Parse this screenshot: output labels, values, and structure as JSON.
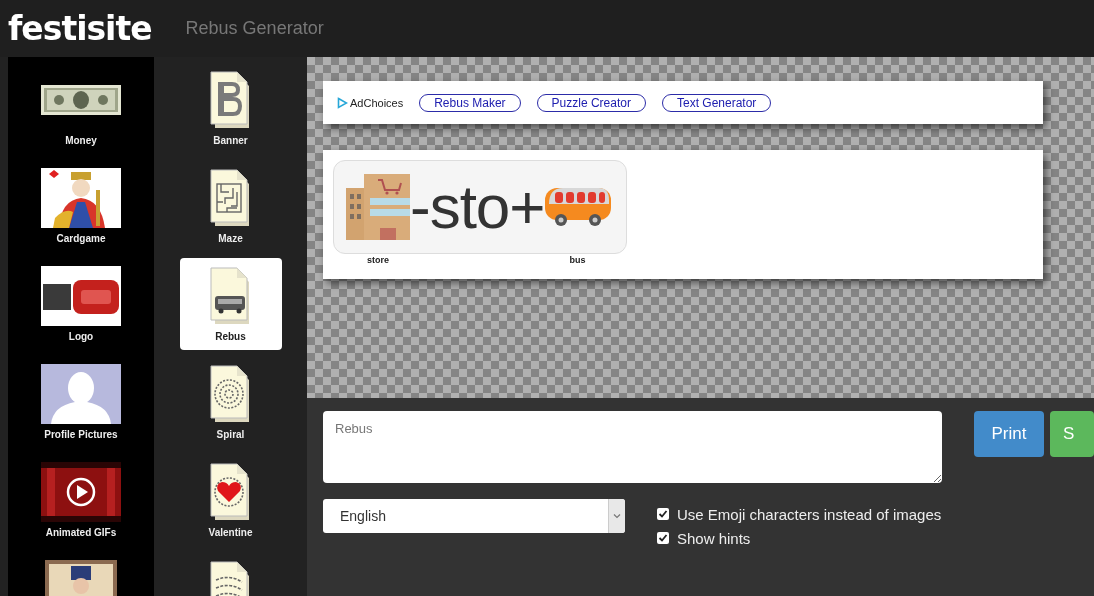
{
  "header": {
    "logo": "festisite",
    "title": "Rebus Generator"
  },
  "sidebar": {
    "columns": [
      {
        "items": [
          {
            "label": "Money",
            "selected": false
          },
          {
            "label": "Cardgame",
            "selected": false
          },
          {
            "label": "Logo",
            "selected": false
          },
          {
            "label": "Profile Pictures",
            "selected": false
          },
          {
            "label": "Animated GIFs",
            "selected": false
          },
          {
            "selected": false
          }
        ]
      },
      {
        "items": [
          {
            "label": "Banner",
            "selected": false
          },
          {
            "label": "Maze",
            "selected": false
          },
          {
            "label": "Rebus",
            "selected": true
          },
          {
            "label": "Spiral",
            "selected": false
          },
          {
            "label": "Valentine",
            "selected": false
          },
          {
            "selected": false
          }
        ]
      }
    ]
  },
  "ad_bar": {
    "adchoices": "AdChoices",
    "links": [
      "Rebus Maker",
      "Puzzle Creator",
      "Text Generator"
    ]
  },
  "rebus": {
    "parts": [
      {
        "kind": "picture",
        "hint": "store"
      },
      {
        "kind": "text",
        "text": "-sto+"
      },
      {
        "kind": "picture",
        "hint": "bus"
      }
    ]
  },
  "controls": {
    "text_input": {
      "placeholder": "Rebus"
    },
    "buttons": [
      {
        "label": "Print",
        "kind": "primary"
      },
      {
        "label": "S",
        "kind": "success"
      }
    ],
    "language": {
      "value": "English"
    },
    "options": [
      {
        "label": "Use Emoji characters instead of images",
        "checked": true
      },
      {
        "label": "Show hints",
        "checked": true
      }
    ]
  }
}
